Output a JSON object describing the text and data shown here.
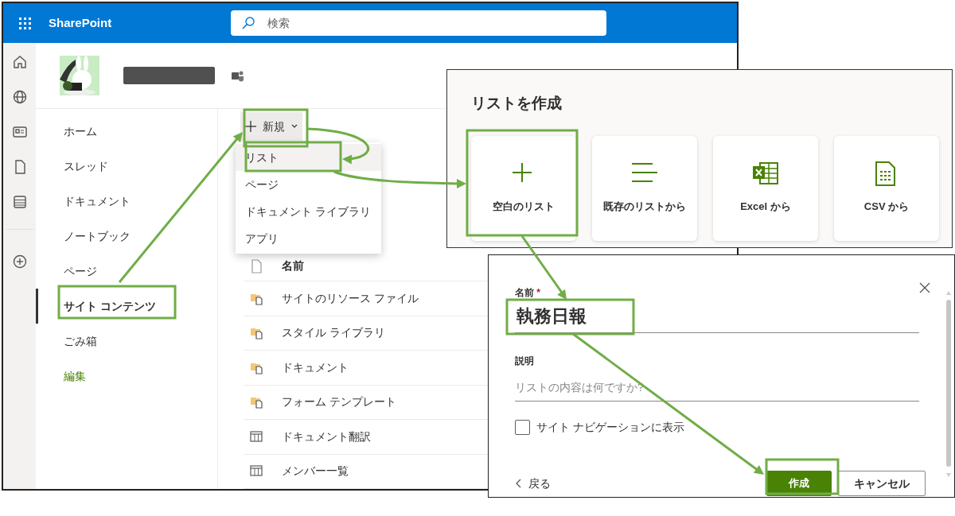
{
  "app": {
    "name": "SharePoint",
    "search_placeholder": "検索"
  },
  "nav": {
    "items": [
      {
        "label": "ホーム",
        "selected": false
      },
      {
        "label": "スレッド",
        "selected": false
      },
      {
        "label": "ドキュメント",
        "selected": false
      },
      {
        "label": "ノートブック",
        "selected": false
      },
      {
        "label": "ページ",
        "selected": false
      },
      {
        "label": "サイト コンテンツ",
        "selected": true
      },
      {
        "label": "ごみ箱",
        "selected": false
      }
    ],
    "edit_link": "編集"
  },
  "command_bar": {
    "new_label": "新規"
  },
  "new_menu": [
    {
      "label": "リスト",
      "selected": true
    },
    {
      "label": "ページ",
      "selected": false
    },
    {
      "label": "ドキュメント ライブラリ",
      "selected": false
    },
    {
      "label": "アプリ",
      "selected": false
    }
  ],
  "table": {
    "columns": [
      "名前"
    ],
    "rows": [
      {
        "kind": "library",
        "name": "サイトのリソース ファイル"
      },
      {
        "kind": "library",
        "name": "スタイル ライブラリ"
      },
      {
        "kind": "library",
        "name": "ドキュメント"
      },
      {
        "kind": "library",
        "name": "フォーム テンプレート"
      },
      {
        "kind": "list",
        "name": "ドキュメント翻訳"
      },
      {
        "kind": "list",
        "name": "メンバー一覧"
      }
    ]
  },
  "create_list": {
    "title": "リストを作成",
    "options": [
      {
        "kind": "blank",
        "label": "空白のリスト"
      },
      {
        "kind": "existing",
        "label": "既存のリストから"
      },
      {
        "kind": "excel",
        "label": "Excel から"
      },
      {
        "kind": "csv",
        "label": "CSV から"
      }
    ]
  },
  "form": {
    "name_label": "名前",
    "required_mark": "*",
    "name_value": "執務日報",
    "description_label": "説明",
    "description_placeholder": "リストの内容は何ですか?",
    "nav_checkbox": {
      "label": "サイト ナビゲーションに表示",
      "checked": false
    },
    "back": "戻る",
    "create": "作成",
    "cancel": "キャンセル"
  }
}
